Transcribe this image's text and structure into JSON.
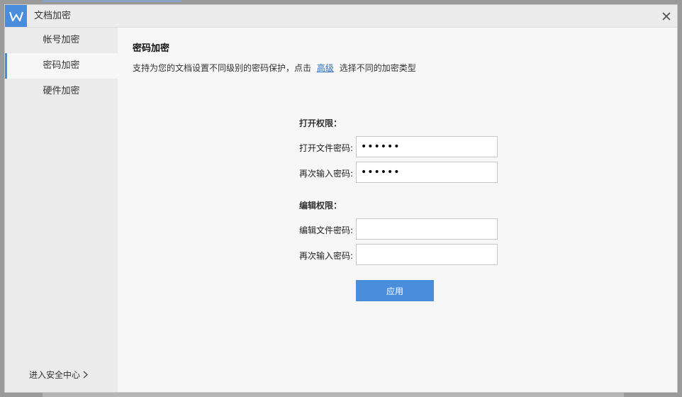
{
  "window": {
    "title": "文档加密",
    "app_icon": "wps-writer-icon",
    "close_icon": "close-icon"
  },
  "sidebar": {
    "items": [
      {
        "label": "帐号加密",
        "active": false
      },
      {
        "label": "密码加密",
        "active": true
      },
      {
        "label": "硬件加密",
        "active": false
      }
    ],
    "security_center_link": "进入安全中心"
  },
  "main": {
    "title": "密码加密",
    "description_prefix": "支持为您的文档设置不同级别的密码保护，点击",
    "description_link": "高级",
    "description_suffix": "选择不同的加密类型",
    "open_section": {
      "label": "打开权限：",
      "password_label": "打开文件密码:",
      "password_value": "••••••",
      "confirm_label": "再次输入密码:",
      "confirm_value": "••••••"
    },
    "edit_section": {
      "label": "编辑权限：",
      "password_label": "编辑文件密码:",
      "password_value": "",
      "confirm_label": "再次输入密码:",
      "confirm_value": ""
    },
    "apply_button": "应用"
  },
  "colors": {
    "accent": "#4a8ddc",
    "link": "#2f6fc0"
  }
}
